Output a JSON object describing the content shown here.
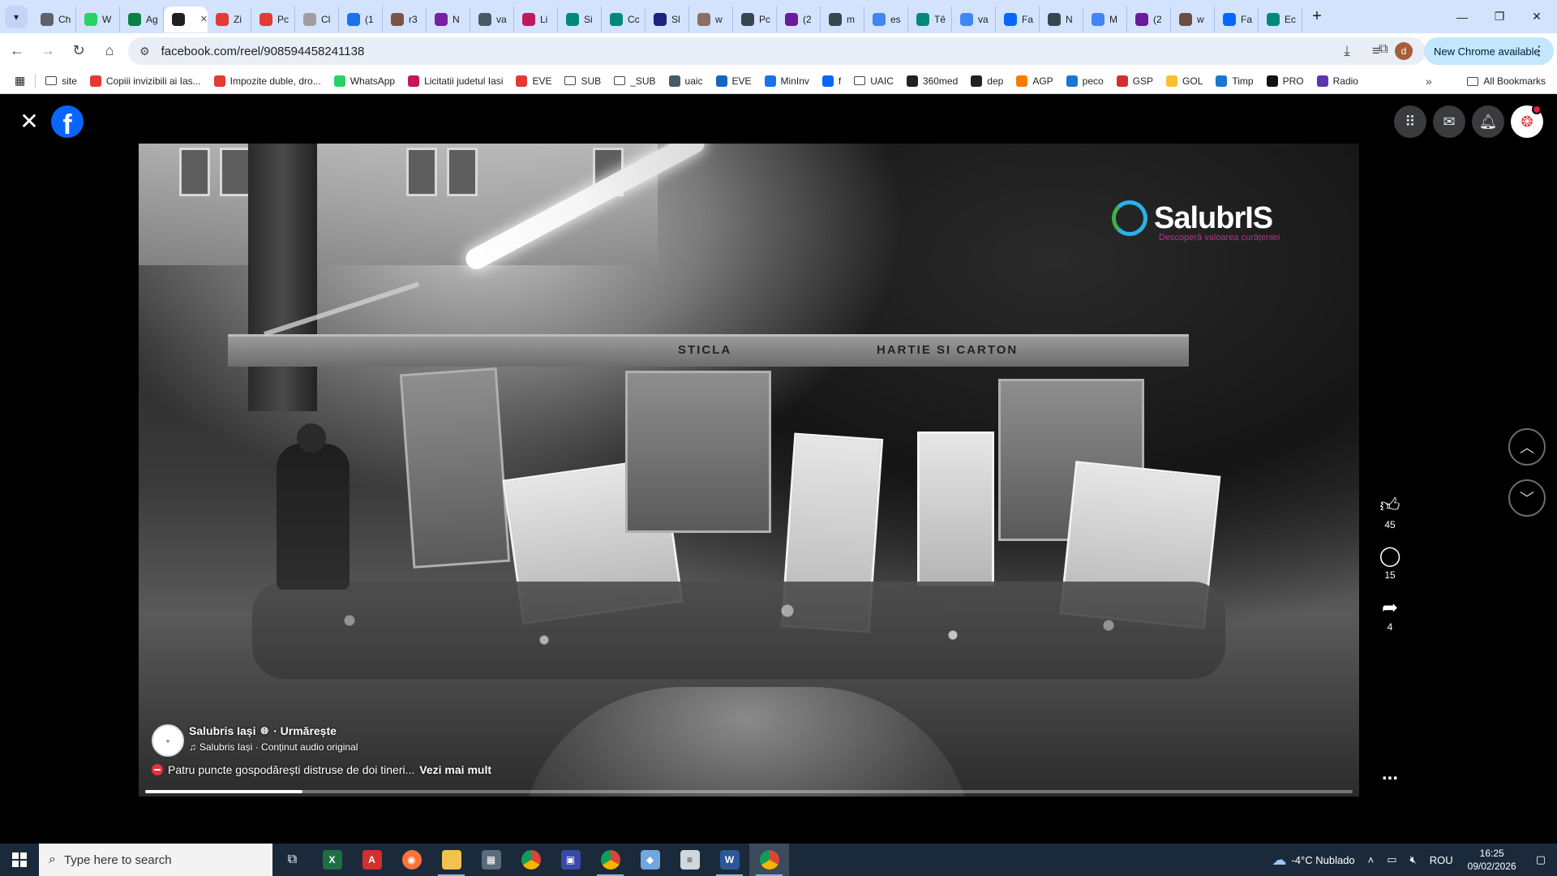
{
  "browser": {
    "tabs": [
      {
        "icon": "chrome-icon",
        "title": "Ch",
        "color": "#5f6368"
      },
      {
        "icon": "whatsapp-icon",
        "title": "W",
        "color": "#25d366"
      },
      {
        "icon": "app-icon",
        "title": "Ag",
        "color": "#0b8043"
      },
      {
        "icon": "speaker-icon",
        "title": "",
        "color": "#1f1f1f",
        "active": true
      },
      {
        "icon": "site-icon",
        "title": "Zi",
        "color": "#e53935"
      },
      {
        "icon": "site-icon",
        "title": "Pc",
        "color": "#e53935"
      },
      {
        "icon": "site-icon",
        "title": "Cl",
        "color": "#9e9e9e"
      },
      {
        "icon": "site-icon",
        "title": "(1",
        "color": "#1a73e8"
      },
      {
        "icon": "site-icon",
        "title": "r3",
        "color": "#795548"
      },
      {
        "icon": "site-icon",
        "title": "N",
        "color": "#7b1fa2"
      },
      {
        "icon": "site-icon",
        "title": "va",
        "color": "#455a64"
      },
      {
        "icon": "site-icon",
        "title": "Li",
        "color": "#c2185b"
      },
      {
        "icon": "site-icon",
        "title": "Si",
        "color": "#00897b"
      },
      {
        "icon": "site-icon",
        "title": "Cc",
        "color": "#00897b"
      },
      {
        "icon": "site-icon",
        "title": "Sl",
        "color": "#1a237e"
      },
      {
        "icon": "site-icon",
        "title": "w",
        "color": "#8d6e63"
      },
      {
        "icon": "site-icon",
        "title": "Pc",
        "color": "#37474f"
      },
      {
        "icon": "site-icon",
        "title": "(2",
        "color": "#6a1b9a"
      },
      {
        "icon": "site-icon",
        "title": "m",
        "color": "#37474f"
      },
      {
        "icon": "google-icon",
        "title": "es",
        "color": "#4285f4"
      },
      {
        "icon": "site-icon",
        "title": "Tê",
        "color": "#00897b"
      },
      {
        "icon": "google-icon",
        "title": "va",
        "color": "#4285f4"
      },
      {
        "icon": "facebook-icon",
        "title": "Fa",
        "color": "#0866ff"
      },
      {
        "icon": "site-icon",
        "title": "N",
        "color": "#37474f"
      },
      {
        "icon": "google-icon",
        "title": "M",
        "color": "#4285f4"
      },
      {
        "icon": "site-icon",
        "title": "(2",
        "color": "#6a1b9a"
      },
      {
        "icon": "site-icon",
        "title": "w",
        "color": "#6d4c41"
      },
      {
        "icon": "facebook-icon",
        "title": "Fa",
        "color": "#0866ff"
      },
      {
        "icon": "site-icon",
        "title": "Ec",
        "color": "#00897b"
      }
    ],
    "url": "facebook.com/reel/908594458241138",
    "update_label": "New Chrome available",
    "profile_initial": "d",
    "bookmarks": [
      {
        "label": "site",
        "type": "folder"
      },
      {
        "label": "Copiii invizibili ai Ias...",
        "type": "link",
        "color": "#e53935"
      },
      {
        "label": "Impozite duble, dro...",
        "type": "link",
        "color": "#e53935"
      },
      {
        "label": "WhatsApp",
        "type": "link",
        "color": "#25d366"
      },
      {
        "label": "Licitatii judetul Iasi",
        "type": "link",
        "color": "#c2185b"
      },
      {
        "label": "EVE",
        "type": "link",
        "color": "#e53935"
      },
      {
        "label": "SUB",
        "type": "folder"
      },
      {
        "label": "_SUB",
        "type": "folder"
      },
      {
        "label": "uaic",
        "type": "link",
        "color": "#455a64"
      },
      {
        "label": "EVE",
        "type": "link",
        "color": "#1565c0"
      },
      {
        "label": "MinInv",
        "type": "link",
        "color": "#1a73e8"
      },
      {
        "label": "f",
        "type": "link",
        "color": "#0866ff"
      },
      {
        "label": "UAIC",
        "type": "folder"
      },
      {
        "label": "360med",
        "type": "link",
        "color": "#212121"
      },
      {
        "label": "dep",
        "type": "link",
        "color": "#212121"
      },
      {
        "label": "AGP",
        "type": "link",
        "color": "#f57c00"
      },
      {
        "label": "peco",
        "type": "link",
        "color": "#1976d2"
      },
      {
        "label": "GSP",
        "type": "link",
        "color": "#d32f2f"
      },
      {
        "label": "GOL",
        "type": "link",
        "color": "#fbc02d"
      },
      {
        "label": "Timp",
        "type": "link",
        "color": "#1976d2"
      },
      {
        "label": "PRO",
        "type": "link",
        "color": "#111111"
      },
      {
        "label": "Radio",
        "type": "link",
        "color": "#5e35b1"
      }
    ],
    "all_bookmarks_label": "All Bookmarks"
  },
  "reel": {
    "page_name": "Salubris Iași",
    "follow_label": "· Urmărește",
    "audio_label": "Salubris Iași · Conținut audio original",
    "caption": "Patru puncte gospodărești distruse de doi tineri...",
    "see_more": "Vezi mai mult",
    "progress": 0.13,
    "likes": "45",
    "comments": "15",
    "shares": "4",
    "more_label": "...",
    "watermark_brand": "SalubrIS",
    "watermark_tagline": "Descoperă valoarea curățeniei",
    "bin_signs": [
      "STICLA",
      "HARTIE SI CARTON"
    ]
  },
  "taskbar": {
    "search_placeholder": "Type here to search",
    "weather": "-4°C  Nublado",
    "language": "ROU",
    "time": "16:25",
    "date": "09/02/2026"
  }
}
